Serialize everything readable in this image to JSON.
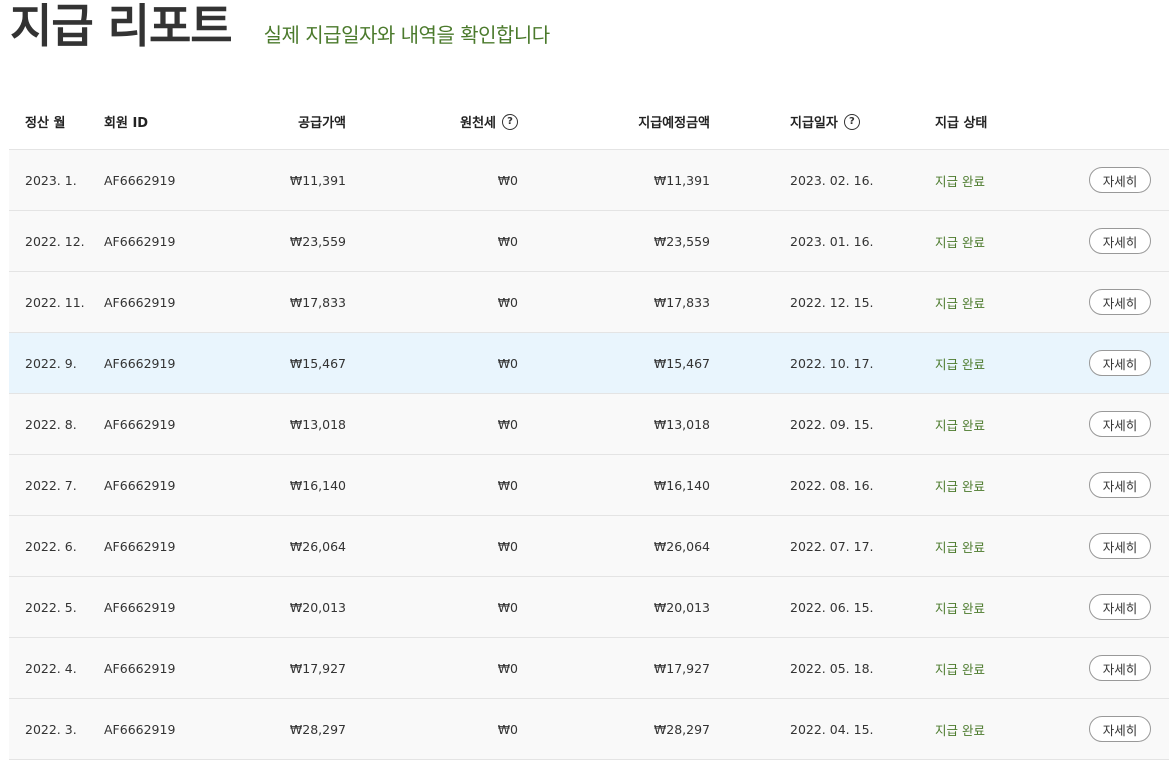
{
  "header": {
    "title": "지급 리포트",
    "subtitle": "실제 지급일자와 내역을 확인합니다"
  },
  "colors": {
    "accent_green": "#4b7a2c",
    "highlight_row": "#e9f5fd",
    "row_bg": "#f9f9f9"
  },
  "table": {
    "columns": {
      "month": "정산 월",
      "member_id": "회원 ID",
      "supply": "공급가액",
      "withholding": "원천세",
      "expected": "지급예정금액",
      "pay_date": "지급일자",
      "status": "지급 상태"
    },
    "help_icon_glyph": "?",
    "detail_label": "자세히",
    "rows": [
      {
        "month": "2023. 1.",
        "id": "AF6662919",
        "supply": "₩11,391",
        "tax": "₩0",
        "expected": "₩11,391",
        "date": "2023. 02. 16.",
        "status": "지급 완료"
      },
      {
        "month": "2022. 12.",
        "id": "AF6662919",
        "supply": "₩23,559",
        "tax": "₩0",
        "expected": "₩23,559",
        "date": "2023. 01. 16.",
        "status": "지급 완료"
      },
      {
        "month": "2022. 11.",
        "id": "AF6662919",
        "supply": "₩17,833",
        "tax": "₩0",
        "expected": "₩17,833",
        "date": "2022. 12. 15.",
        "status": "지급 완료"
      },
      {
        "month": "2022. 9.",
        "id": "AF6662919",
        "supply": "₩15,467",
        "tax": "₩0",
        "expected": "₩15,467",
        "date": "2022. 10. 17.",
        "status": "지급 완료"
      },
      {
        "month": "2022. 8.",
        "id": "AF6662919",
        "supply": "₩13,018",
        "tax": "₩0",
        "expected": "₩13,018",
        "date": "2022. 09. 15.",
        "status": "지급 완료"
      },
      {
        "month": "2022. 7.",
        "id": "AF6662919",
        "supply": "₩16,140",
        "tax": "₩0",
        "expected": "₩16,140",
        "date": "2022. 08. 16.",
        "status": "지급 완료"
      },
      {
        "month": "2022. 6.",
        "id": "AF6662919",
        "supply": "₩26,064",
        "tax": "₩0",
        "expected": "₩26,064",
        "date": "2022. 07. 17.",
        "status": "지급 완료"
      },
      {
        "month": "2022. 5.",
        "id": "AF6662919",
        "supply": "₩20,013",
        "tax": "₩0",
        "expected": "₩20,013",
        "date": "2022. 06. 15.",
        "status": "지급 완료"
      },
      {
        "month": "2022. 4.",
        "id": "AF6662919",
        "supply": "₩17,927",
        "tax": "₩0",
        "expected": "₩17,927",
        "date": "2022. 05. 18.",
        "status": "지급 완료"
      },
      {
        "month": "2022. 3.",
        "id": "AF6662919",
        "supply": "₩28,297",
        "tax": "₩0",
        "expected": "₩28,297",
        "date": "2022. 04. 15.",
        "status": "지급 완료"
      }
    ]
  }
}
